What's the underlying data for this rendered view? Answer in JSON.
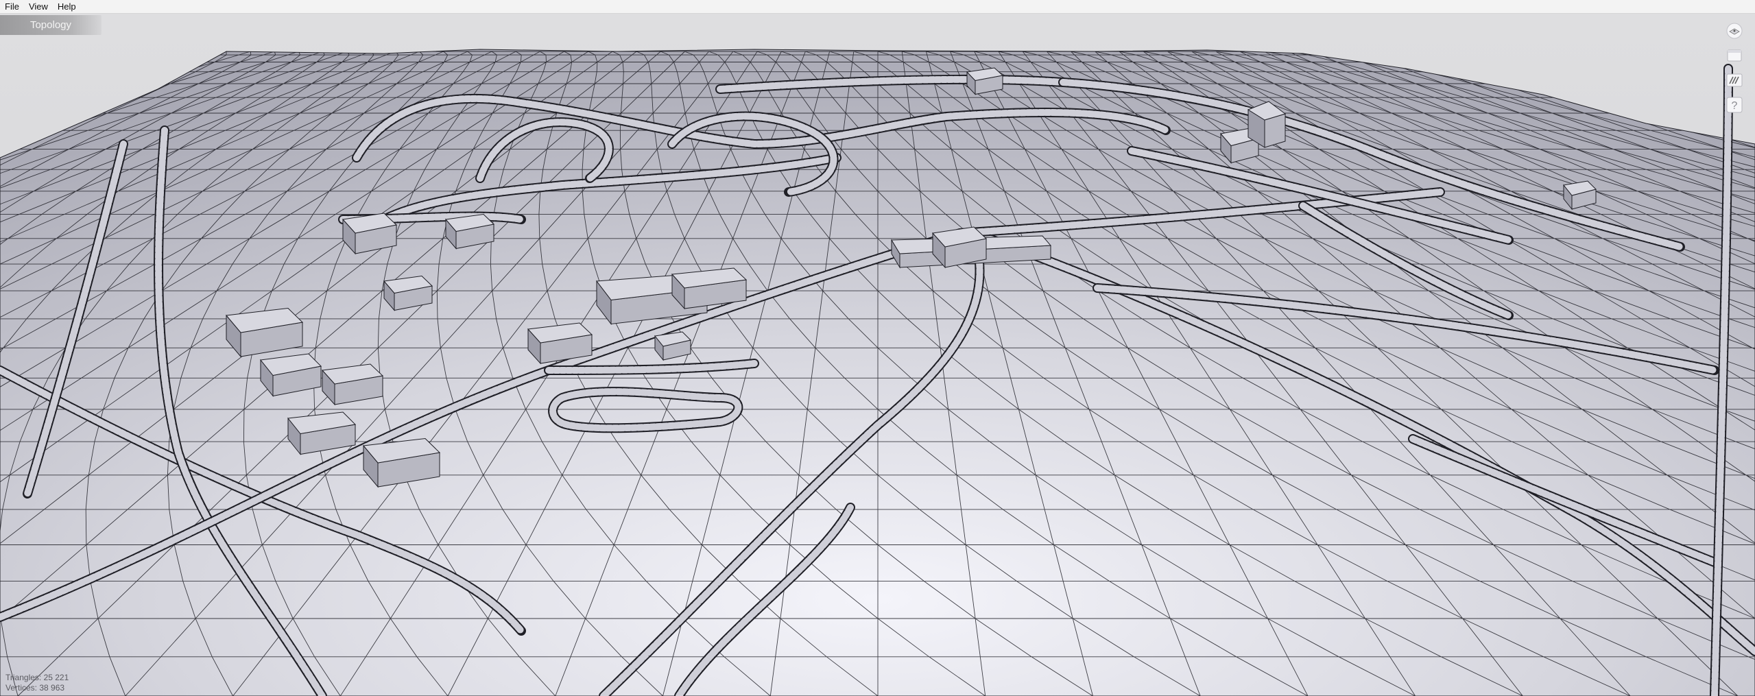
{
  "menu": {
    "items": [
      "File",
      "View",
      "Help"
    ]
  },
  "panel": {
    "title": "Topology"
  },
  "tools": {
    "items": [
      {
        "name": "view-orientation-icon"
      },
      {
        "name": "window-icon"
      },
      {
        "name": "layers-icon"
      },
      {
        "name": "help-icon",
        "glyph": "?"
      }
    ]
  },
  "stats": {
    "triangles": "Triangles: 25 221",
    "vertices": "Vertices: 38 963"
  },
  "colors": {
    "terrain_light": "#eeeef4",
    "terrain_mid": "#c8c8d0",
    "terrain_dark": "#a9a9b4",
    "edge": "#1f1f26",
    "sky": "#dcdcde"
  }
}
